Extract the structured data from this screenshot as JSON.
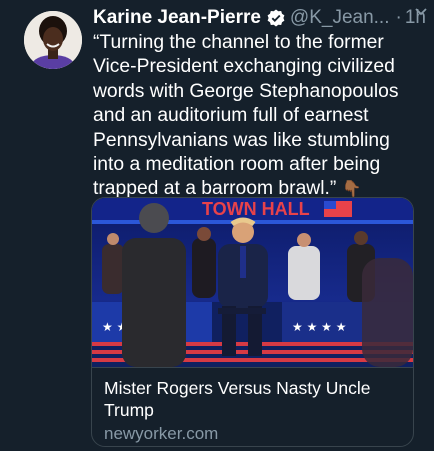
{
  "tweet": {
    "author": {
      "display_name": "Karine Jean-Pierre",
      "handle": "@K_Jean...",
      "verified": true
    },
    "separator": "·",
    "timestamp": "1h",
    "text": "“Turning the channel to the former Vice-President exchanging civilized words with George Stephanopoulos and an auditorium full of earnest Pennsylvanians was like stumbling into a meditation room after being trapped at a barroom brawl.”",
    "emoji": "👇🏾",
    "icons": {
      "verified": "verified-badge-icon",
      "menu": "chevron-down-icon",
      "emoji": "backhand-index-pointing-down-icon"
    }
  },
  "link_card": {
    "image_banner_text": "TOWN HALL",
    "title": "Mister Rogers Versus Nasty Uncle Trump",
    "domain": "newyorker.com"
  },
  "colors": {
    "background": "#15202b",
    "text_primary": "#ffffff",
    "text_secondary": "#8899a6",
    "verified": "#ffffff",
    "border": "#38444d"
  }
}
